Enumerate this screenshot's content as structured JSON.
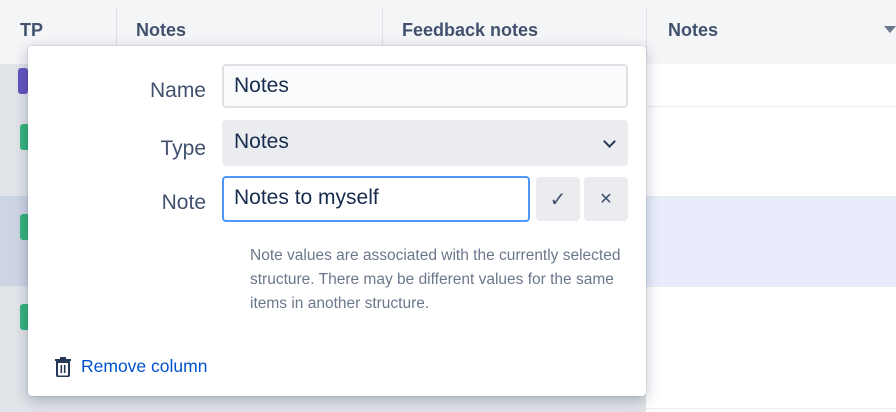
{
  "table": {
    "columns": [
      {
        "label": "TP"
      },
      {
        "label": "Notes"
      },
      {
        "label": "Feedback notes"
      },
      {
        "label": "Notes"
      }
    ]
  },
  "popup": {
    "name_label": "Name",
    "name_value": "Notes",
    "type_label": "Type",
    "type_value": "Notes",
    "note_label": "Note",
    "note_value": "Notes to myself",
    "confirm_icon": "✓",
    "cancel_icon": "✕",
    "help_text": "Note values are associated with the currently selected structure. There may be different values for the same items in another structure.",
    "remove_label": "Remove column"
  },
  "icons": {
    "confirm": "checkmark-icon",
    "cancel": "close-icon",
    "remove": "trash-icon",
    "sort": "sort-down-icon",
    "select": "chevron-down-icon"
  },
  "colors": {
    "accent": "#4c9aff",
    "link": "#0052cc",
    "status_purple": "#6554c0",
    "status_green": "#36b37e",
    "row_selected": "#e9edfb"
  }
}
